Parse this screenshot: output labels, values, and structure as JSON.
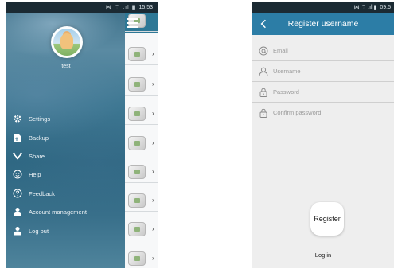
{
  "left_screen": {
    "status_time": "15:53",
    "status_icons": "⋈ ⌔ .ıl ▮",
    "username": "test",
    "menu": [
      {
        "label": "Settings",
        "icon": "gear-icon"
      },
      {
        "label": "Backup",
        "icon": "backup-icon"
      },
      {
        "label": "Share",
        "icon": "share-icon"
      },
      {
        "label": "Help",
        "icon": "smiley-icon"
      },
      {
        "label": "Feedback",
        "icon": "question-icon"
      },
      {
        "label": "Account management",
        "icon": "person-icon"
      },
      {
        "label": "Log out",
        "icon": "person-icon"
      }
    ]
  },
  "right_screen": {
    "status_time": "09:5",
    "status_icons": "⋈ ⌔ .ıl ▮",
    "title": "Register username",
    "fields": {
      "email_placeholder": "Email",
      "username_placeholder": "Username",
      "password_placeholder": "Password",
      "confirm_placeholder": "Confirm password"
    },
    "register_label": "Register",
    "login_label": "Log in"
  },
  "colors": {
    "titlebar": "#2c7da6",
    "status_bar": "#1b2a33",
    "sidebar": "#3f7893"
  }
}
